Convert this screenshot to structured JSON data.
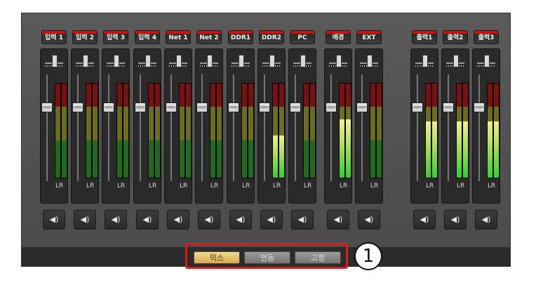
{
  "channels": [
    {
      "label": "입력 1",
      "mute": "◀)",
      "meter_level": 0.0
    },
    {
      "label": "입력 2",
      "mute": "◀)",
      "meter_level": 0.0
    },
    {
      "label": "입력 3",
      "mute": "◀)",
      "meter_level": 0.0
    },
    {
      "label": "입력 4",
      "mute": "◀)",
      "meter_level": 0.0
    },
    {
      "label": "Net 1",
      "mute": "◀)",
      "meter_level": 0.0
    },
    {
      "label": "Net 2",
      "mute": "◀)",
      "meter_level": 0.0
    },
    {
      "label": "DDR1",
      "mute": "◀)",
      "meter_level": 0.0
    },
    {
      "label": "DDR2",
      "mute": "◀)",
      "meter_level": 0.45
    },
    {
      "label": "PC",
      "mute": "◀)",
      "meter_level": 0.0
    },
    {
      "label": "배경",
      "mute": "◀)",
      "meter_level": 0.62
    },
    {
      "label": "EXT",
      "mute": "◀)",
      "meter_level": 0.0
    }
  ],
  "outputs": [
    {
      "label": "출력1",
      "mute": "◀)",
      "meter_level": 0.6
    },
    {
      "label": "출력2",
      "mute": "◀)",
      "meter_level": 0.6
    },
    {
      "label": "출력3",
      "mute": "◀)",
      "meter_level": 0.6
    }
  ],
  "meter_label": "LR",
  "modes": [
    {
      "label": "믹스",
      "active": true
    },
    {
      "label": "연동",
      "active": false
    },
    {
      "label": "고정",
      "active": false
    }
  ],
  "callout_number": "1",
  "colors": {
    "highlight": "#e01818",
    "active_mode": "#d8a94e",
    "label_cap": "#c81414"
  }
}
